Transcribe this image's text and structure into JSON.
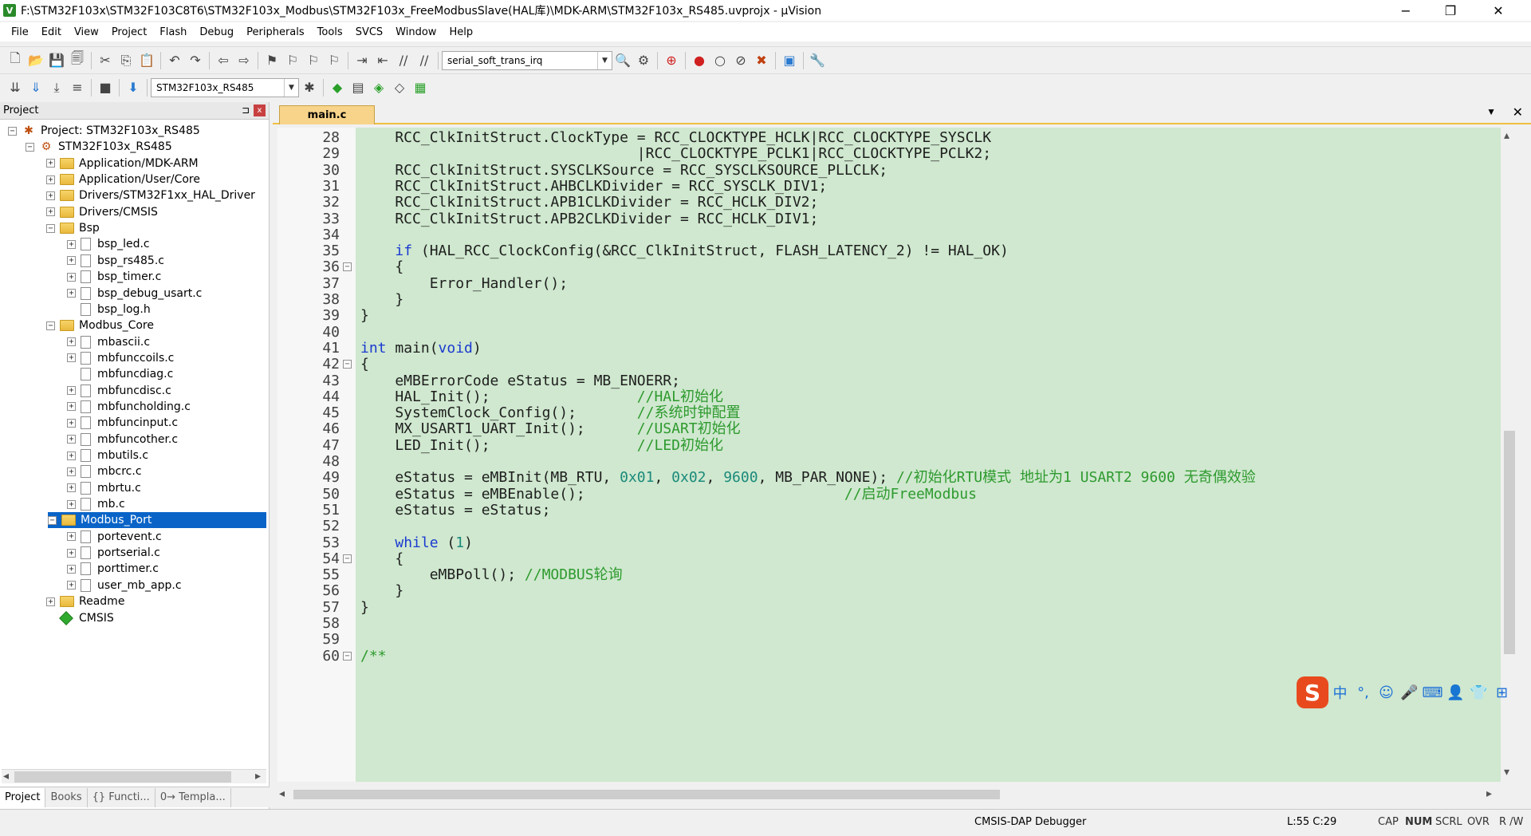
{
  "window": {
    "title": "F:\\STM32F103x\\STM32F103C8T6\\STM32F103x_Modbus\\STM32F103x_FreeModbusSlave(HAL库)\\MDK-ARM\\STM32F103x_RS485.uvprojx - µVision",
    "app_icon": "V",
    "minimize": "−",
    "maximize": "❐",
    "close": "✕"
  },
  "menu": [
    "File",
    "Edit",
    "View",
    "Project",
    "Flash",
    "Debug",
    "Peripherals",
    "Tools",
    "SVCS",
    "Window",
    "Help"
  ],
  "toolbar1": {
    "buttons_a": [
      "new-file-icon",
      "open-icon",
      "save-icon",
      "save-all-icon"
    ],
    "buttons_b": [
      "cut-icon",
      "copy-icon",
      "paste-icon"
    ],
    "buttons_c": [
      "undo-icon",
      "redo-icon"
    ],
    "buttons_d": [
      "nav-back-icon",
      "nav-forward-icon"
    ],
    "buttons_e": [
      "bookmark-set-icon",
      "bookmark-prev-icon",
      "bookmark-next-icon",
      "bookmark-clear-icon"
    ],
    "buttons_f": [
      "indent-icon",
      "unindent-icon",
      "comment-icon",
      "uncomment-icon"
    ],
    "find_combo_value": "serial_soft_trans_irq",
    "buttons_g": [
      "find-in-files-icon",
      "incremental-find-icon"
    ],
    "buttons_h": [
      "debug-session-icon"
    ],
    "buttons_i": [
      "breakpoint-icon",
      "breakpoint-disable-icon",
      "breakpoint-disable-all-icon",
      "breakpoint-kill-all-icon"
    ],
    "buttons_j": [
      "window-layout-icon"
    ],
    "buttons_k": [
      "configure-icon"
    ]
  },
  "toolbar2": {
    "buttons_a": [
      "translate-icon",
      "build-icon",
      "rebuild-icon",
      "batch-build-icon"
    ],
    "buttons_b": [
      "stop-build-icon"
    ],
    "buttons_c": [
      "download-icon"
    ],
    "target_combo_value": "STM32F103x_RS485",
    "buttons_d": [
      "target-options-icon"
    ],
    "buttons_e": [
      "manage-components-icon",
      "file-extensions-icon",
      "select-packs-icon",
      "pack-installer-icon",
      "rte-icon"
    ]
  },
  "project_panel": {
    "title": "Project",
    "pin": "⊐",
    "close": "x",
    "tree": [
      {
        "label": "Project: STM32F103x_RS485",
        "level": 0,
        "kind": "project",
        "exp": "−"
      },
      {
        "label": "STM32F103x_RS485",
        "level": 1,
        "kind": "target",
        "exp": "−"
      },
      {
        "label": "Application/MDK-ARM",
        "level": 2,
        "kind": "folder",
        "exp": "+"
      },
      {
        "label": "Application/User/Core",
        "level": 2,
        "kind": "folder",
        "exp": "+"
      },
      {
        "label": "Drivers/STM32F1xx_HAL_Driver",
        "level": 2,
        "kind": "folder",
        "exp": "+"
      },
      {
        "label": "Drivers/CMSIS",
        "level": 2,
        "kind": "folder",
        "exp": "+"
      },
      {
        "label": "Bsp",
        "level": 2,
        "kind": "folder",
        "exp": "−"
      },
      {
        "label": "bsp_led.c",
        "level": 3,
        "kind": "file",
        "exp": "+"
      },
      {
        "label": "bsp_rs485.c",
        "level": 3,
        "kind": "file",
        "exp": "+"
      },
      {
        "label": "bsp_timer.c",
        "level": 3,
        "kind": "file",
        "exp": "+"
      },
      {
        "label": "bsp_debug_usart.c",
        "level": 3,
        "kind": "file",
        "exp": "+"
      },
      {
        "label": "bsp_log.h",
        "level": 3,
        "kind": "file",
        "exp": ""
      },
      {
        "label": "Modbus_Core",
        "level": 2,
        "kind": "folder",
        "exp": "−"
      },
      {
        "label": "mbascii.c",
        "level": 3,
        "kind": "file",
        "exp": "+"
      },
      {
        "label": "mbfunccoils.c",
        "level": 3,
        "kind": "file",
        "exp": "+"
      },
      {
        "label": "mbfuncdiag.c",
        "level": 3,
        "kind": "file",
        "exp": ""
      },
      {
        "label": "mbfuncdisc.c",
        "level": 3,
        "kind": "file",
        "exp": "+"
      },
      {
        "label": "mbfuncholding.c",
        "level": 3,
        "kind": "file",
        "exp": "+"
      },
      {
        "label": "mbfuncinput.c",
        "level": 3,
        "kind": "file",
        "exp": "+"
      },
      {
        "label": "mbfuncother.c",
        "level": 3,
        "kind": "file",
        "exp": "+"
      },
      {
        "label": "mbutils.c",
        "level": 3,
        "kind": "file",
        "exp": "+"
      },
      {
        "label": "mbcrc.c",
        "level": 3,
        "kind": "file",
        "exp": "+"
      },
      {
        "label": "mbrtu.c",
        "level": 3,
        "kind": "file",
        "exp": "+"
      },
      {
        "label": "mb.c",
        "level": 3,
        "kind": "file",
        "exp": "+"
      },
      {
        "label": "Modbus_Port",
        "level": 2,
        "kind": "folder",
        "exp": "−",
        "selected": true
      },
      {
        "label": "portevent.c",
        "level": 3,
        "kind": "file",
        "exp": "+"
      },
      {
        "label": "portserial.c",
        "level": 3,
        "kind": "file",
        "exp": "+"
      },
      {
        "label": "porttimer.c",
        "level": 3,
        "kind": "file",
        "exp": "+"
      },
      {
        "label": "user_mb_app.c",
        "level": 3,
        "kind": "file",
        "exp": "+"
      },
      {
        "label": "Readme",
        "level": 2,
        "kind": "folder",
        "exp": "+"
      },
      {
        "label": "CMSIS",
        "level": 2,
        "kind": "cmsis",
        "exp": ""
      }
    ],
    "tabs": [
      "Project",
      "Books",
      "{} Functi...",
      "0→ Templa..."
    ]
  },
  "editor": {
    "tab": "main.c",
    "tab_dropdown": "▼",
    "tab_close": "✕",
    "lines": [
      {
        "n": "28",
        "fold": "",
        "segs": [
          {
            "t": "    RCC_ClkInitStruct.ClockType = RCC_CLOCKTYPE_HCLK|RCC_CLOCKTYPE_SYSCLK",
            "c": ""
          }
        ]
      },
      {
        "n": "29",
        "fold": "",
        "segs": [
          {
            "t": "                                |RCC_CLOCKTYPE_PCLK1|RCC_CLOCKTYPE_PCLK2;",
            "c": ""
          }
        ]
      },
      {
        "n": "30",
        "fold": "",
        "segs": [
          {
            "t": "    RCC_ClkInitStruct.SYSCLKSource = RCC_SYSCLKSOURCE_PLLCLK;",
            "c": ""
          }
        ]
      },
      {
        "n": "31",
        "fold": "",
        "segs": [
          {
            "t": "    RCC_ClkInitStruct.AHBCLKDivider = RCC_SYSCLK_DIV1;",
            "c": ""
          }
        ]
      },
      {
        "n": "32",
        "fold": "",
        "segs": [
          {
            "t": "    RCC_ClkInitStruct.APB1CLKDivider = RCC_HCLK_DIV2;",
            "c": ""
          }
        ]
      },
      {
        "n": "33",
        "fold": "",
        "segs": [
          {
            "t": "    RCC_ClkInitStruct.APB2CLKDivider = RCC_HCLK_DIV1;",
            "c": ""
          }
        ]
      },
      {
        "n": "34",
        "fold": "",
        "segs": [
          {
            "t": "",
            "c": ""
          }
        ]
      },
      {
        "n": "35",
        "fold": "",
        "segs": [
          {
            "t": "    ",
            "c": ""
          },
          {
            "t": "if",
            "c": "kw"
          },
          {
            "t": " (HAL_RCC_ClockConfig(&RCC_ClkInitStruct, FLASH_LATENCY_2) != HAL_OK)",
            "c": ""
          }
        ]
      },
      {
        "n": "36",
        "fold": "−",
        "segs": [
          {
            "t": "    {",
            "c": ""
          }
        ]
      },
      {
        "n": "37",
        "fold": "",
        "segs": [
          {
            "t": "        Error_Handler();",
            "c": ""
          }
        ]
      },
      {
        "n": "38",
        "fold": "",
        "segs": [
          {
            "t": "    }",
            "c": ""
          }
        ]
      },
      {
        "n": "39",
        "fold": "",
        "segs": [
          {
            "t": "}",
            "c": ""
          }
        ]
      },
      {
        "n": "40",
        "fold": "",
        "segs": [
          {
            "t": "",
            "c": ""
          }
        ]
      },
      {
        "n": "41",
        "fold": "",
        "segs": [
          {
            "t": "int",
            "c": "kw"
          },
          {
            "t": " main(",
            "c": ""
          },
          {
            "t": "void",
            "c": "kw"
          },
          {
            "t": ")",
            "c": ""
          }
        ]
      },
      {
        "n": "42",
        "fold": "−",
        "segs": [
          {
            "t": "{",
            "c": ""
          }
        ]
      },
      {
        "n": "43",
        "fold": "",
        "segs": [
          {
            "t": "    eMBErrorCode eStatus = MB_ENOERR;",
            "c": ""
          }
        ]
      },
      {
        "n": "44",
        "fold": "",
        "segs": [
          {
            "t": "    HAL_Init();                 ",
            "c": ""
          },
          {
            "t": "//HAL初始化",
            "c": "cm"
          }
        ]
      },
      {
        "n": "45",
        "fold": "",
        "segs": [
          {
            "t": "    SystemClock_Config();       ",
            "c": ""
          },
          {
            "t": "//系统时钟配置",
            "c": "cm"
          }
        ]
      },
      {
        "n": "46",
        "fold": "",
        "segs": [
          {
            "t": "    MX_USART1_UART_Init();      ",
            "c": ""
          },
          {
            "t": "//USART初始化",
            "c": "cm"
          }
        ]
      },
      {
        "n": "47",
        "fold": "",
        "segs": [
          {
            "t": "    LED_Init();                 ",
            "c": ""
          },
          {
            "t": "//LED初始化",
            "c": "cm"
          }
        ]
      },
      {
        "n": "48",
        "fold": "",
        "segs": [
          {
            "t": "",
            "c": ""
          }
        ]
      },
      {
        "n": "49",
        "fold": "",
        "segs": [
          {
            "t": "    eStatus = eMBInit(MB_RTU, ",
            "c": ""
          },
          {
            "t": "0x01",
            "c": "num"
          },
          {
            "t": ", ",
            "c": ""
          },
          {
            "t": "0x02",
            "c": "num"
          },
          {
            "t": ", ",
            "c": ""
          },
          {
            "t": "9600",
            "c": "num"
          },
          {
            "t": ", MB_PAR_NONE); ",
            "c": ""
          },
          {
            "t": "//初始化RTU模式 地址为1 USART2 9600 无奇偶效验",
            "c": "cm"
          }
        ]
      },
      {
        "n": "50",
        "fold": "",
        "segs": [
          {
            "t": "    eStatus = eMBEnable();                              ",
            "c": ""
          },
          {
            "t": "//启动FreeModbus",
            "c": "cm"
          }
        ]
      },
      {
        "n": "51",
        "fold": "",
        "segs": [
          {
            "t": "    eStatus = eStatus;",
            "c": ""
          }
        ]
      },
      {
        "n": "52",
        "fold": "",
        "segs": [
          {
            "t": "",
            "c": ""
          }
        ]
      },
      {
        "n": "53",
        "fold": "",
        "segs": [
          {
            "t": "    ",
            "c": ""
          },
          {
            "t": "while",
            "c": "kw"
          },
          {
            "t": " (",
            "c": ""
          },
          {
            "t": "1",
            "c": "num"
          },
          {
            "t": ")",
            "c": ""
          }
        ]
      },
      {
        "n": "54",
        "fold": "−",
        "segs": [
          {
            "t": "    {",
            "c": ""
          }
        ]
      },
      {
        "n": "55",
        "fold": "",
        "segs": [
          {
            "t": "        eMBPoll(); ",
            "c": ""
          },
          {
            "t": "//MODBUS轮询",
            "c": "cm"
          }
        ]
      },
      {
        "n": "56",
        "fold": "",
        "segs": [
          {
            "t": "    }",
            "c": ""
          }
        ]
      },
      {
        "n": "57",
        "fold": "",
        "segs": [
          {
            "t": "}",
            "c": ""
          }
        ]
      },
      {
        "n": "58",
        "fold": "",
        "segs": [
          {
            "t": "",
            "c": ""
          }
        ]
      },
      {
        "n": "59",
        "fold": "",
        "segs": [
          {
            "t": "",
            "c": ""
          }
        ]
      },
      {
        "n": "60",
        "fold": "−",
        "segs": [
          {
            "t": "/**",
            "c": "cm"
          }
        ]
      }
    ]
  },
  "ime": {
    "logo": "S",
    "items": [
      "中",
      "°,",
      "☺",
      "🎤",
      "⌨",
      "👤",
      "👕",
      "⊞"
    ]
  },
  "status": {
    "debugger": "CMSIS-DAP Debugger",
    "position": "L:55 C:29",
    "indicators": [
      "CAP",
      "NUM",
      "SCRL",
      "OVR",
      "R /W"
    ]
  },
  "colors": {
    "editor_bg": "#cfe8cf",
    "selection": "#0a64c8",
    "keyword": "#1a3ad0",
    "comment": "#2e9a2e",
    "number": "#1a8a7a"
  }
}
